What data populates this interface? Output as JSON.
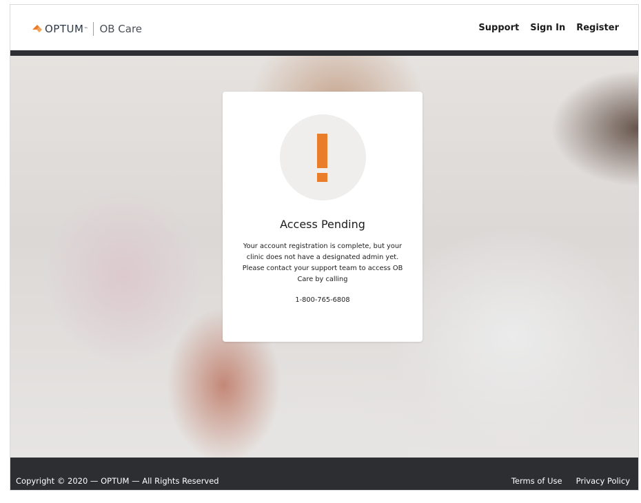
{
  "header": {
    "brand": "OPTUM",
    "brand_tm": "™",
    "product": "OB Care",
    "nav": [
      {
        "label": "Support"
      },
      {
        "label": "Sign In"
      },
      {
        "label": "Register"
      }
    ]
  },
  "card": {
    "icon": "exclamation-icon",
    "accent_color": "#ea7d29",
    "title": "Access Pending",
    "message": "Your account registration is complete, but your clinic does not have a designated admin yet. Please contact your support team to access OB Care by calling",
    "phone": "1-800-765-6808"
  },
  "footer": {
    "copyright": "Copyright © 2020 — OPTUM — All Rights Reserved",
    "links": [
      {
        "label": "Terms of Use"
      },
      {
        "label": "Privacy Policy"
      }
    ]
  },
  "colors": {
    "header_bar": "#2d2f33",
    "footer_bg": "#2c2e31",
    "brand_orange": "#ea7d29"
  }
}
